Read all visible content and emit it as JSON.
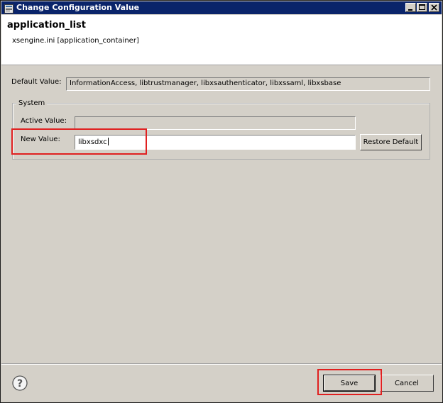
{
  "window": {
    "title": "Change Configuration Value"
  },
  "header": {
    "title": "application_list",
    "subtitle": "xsengine.ini [application_container]"
  },
  "default_value": {
    "label": "Default Value:",
    "value": "InformationAccess, libtrustmanager, libxsauthenticator, libxssaml, libxsbase"
  },
  "system_group": {
    "legend": "System",
    "active_value_label": "Active Value:",
    "active_value": "",
    "new_value_label": "New Value:",
    "new_value": "libxsdxc",
    "restore_default_label": "Restore Default"
  },
  "footer": {
    "save_label": "Save",
    "cancel_label": "Cancel"
  },
  "colors": {
    "titlebar": "#0a246a",
    "highlight": "#e02020",
    "dialog_bg": "#d4d0c8"
  },
  "icons": [
    "window-icon",
    "minimize-icon",
    "maximize-icon",
    "close-icon",
    "help-icon"
  ]
}
